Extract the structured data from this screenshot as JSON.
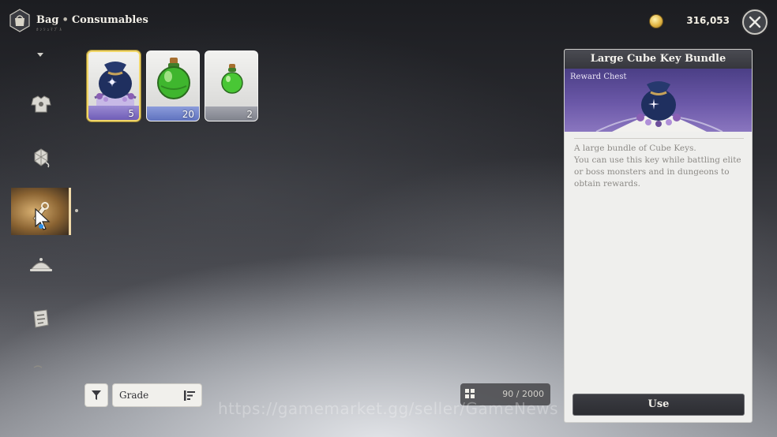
{
  "header": {
    "bag_label": "Bag",
    "separator": "•",
    "category_label": "Consumables",
    "subtitle": "ｶﾝｼｭﾏﾌﾞﾙ",
    "currency_amount": "316,053"
  },
  "sidebar": {
    "items": [
      {
        "icon": "armor-icon",
        "active": false
      },
      {
        "icon": "material-icon",
        "active": false
      },
      {
        "icon": "consumable-icon",
        "active": true
      },
      {
        "icon": "food-cloche-icon",
        "active": false
      },
      {
        "icon": "map-scroll-icon",
        "active": false
      }
    ]
  },
  "inventory": {
    "items": [
      {
        "name": "Large Cube Key Bundle",
        "count": "5",
        "grade_color": "#7d6bc4",
        "selected": true
      },
      {
        "name": "Green Potion (Large)",
        "count": "20",
        "grade_color": "#6d82c9",
        "selected": false
      },
      {
        "name": "Green Potion",
        "count": "2",
        "grade_color": "#8a8d99",
        "selected": false
      }
    ]
  },
  "controls": {
    "sort_label": "Grade",
    "capacity": "90 / 2000"
  },
  "watermark": "https://gamemarket.gg/seller/GameNews",
  "detail": {
    "title": "Large Cube Key Bundle",
    "type": "Reward Chest",
    "description": "A large bundle of Cube Keys.\nYou can use this key while battling elite or boss monsters and in dungeons to obtain rewards.",
    "use_label": "Use"
  },
  "colors": {
    "accent_gold": "#f1d76a",
    "panel_purple": "#6b58a8",
    "active_tab": "#d8b071"
  }
}
